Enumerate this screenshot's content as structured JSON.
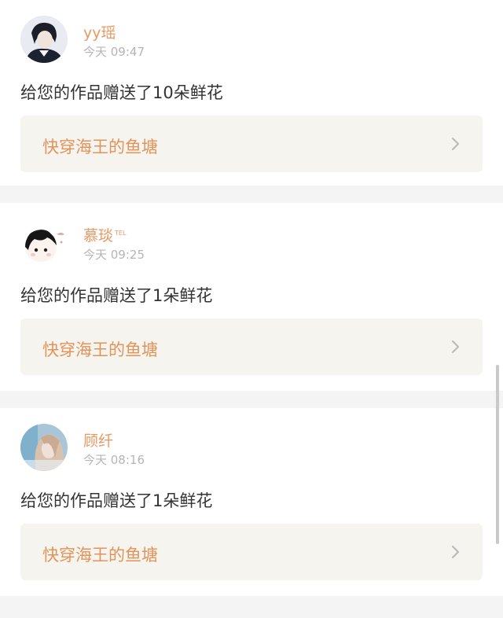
{
  "notifications": [
    {
      "username": "yy瑶",
      "badge": "",
      "timestamp": "今天 09:47",
      "message": "给您的作品赠送了10朵鲜花",
      "work_title": "快穿海王的鱼塘",
      "avatar": "dark-portrait"
    },
    {
      "username": "慕琰",
      "badge": "TEL",
      "timestamp": "今天 09:25",
      "message": "给您的作品赠送了1朵鲜花",
      "work_title": "快穿海王的鱼塘",
      "avatar": "cartoon-character"
    },
    {
      "username": "顾纤",
      "badge": "",
      "timestamp": "今天 08:16",
      "message": "给您的作品赠送了1朵鲜花",
      "work_title": "快穿海王的鱼塘",
      "avatar": "light-portrait"
    }
  ],
  "colors": {
    "username": "#e79a63",
    "work_title": "#e3935a",
    "timestamp": "#b5b5b5",
    "message": "#333333",
    "link_bg": "#f5f4ee",
    "page_bg": "#f4f4f4"
  }
}
